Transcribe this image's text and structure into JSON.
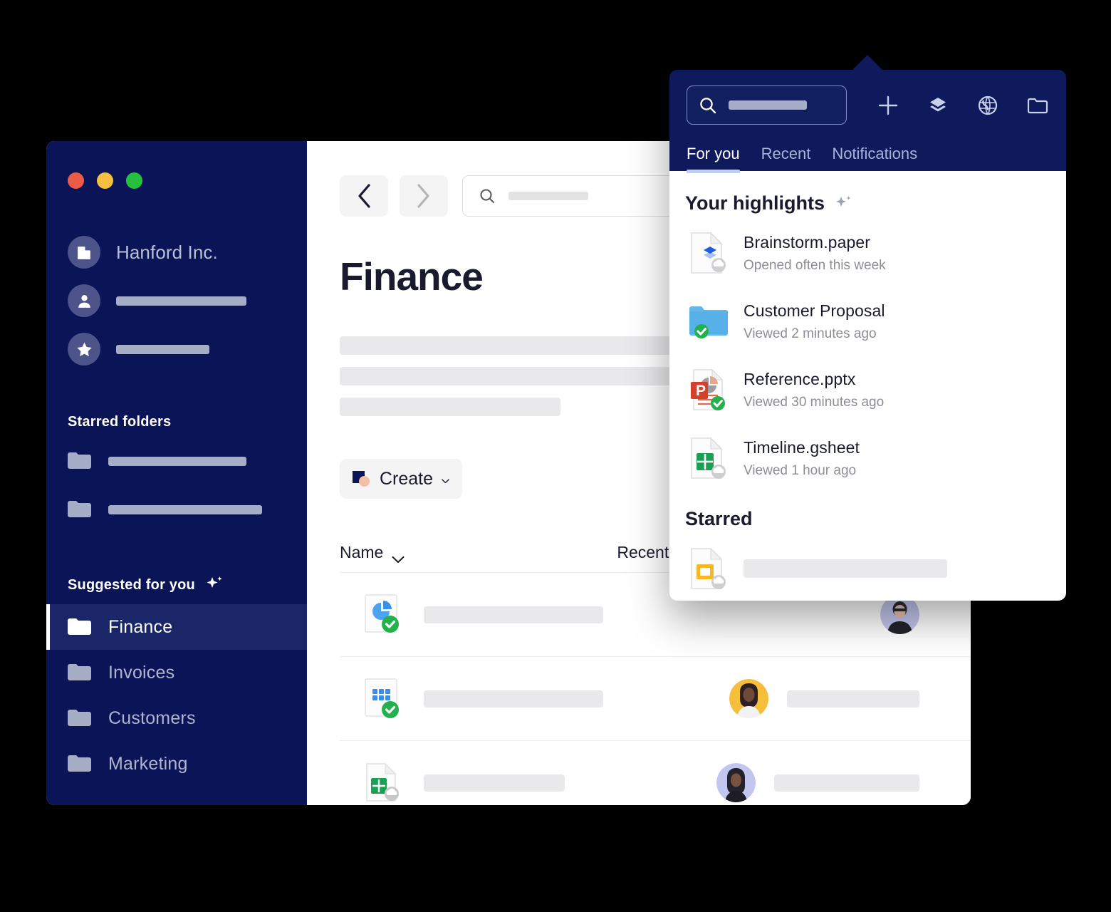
{
  "window": {
    "traffic_lights": [
      "close",
      "minimize",
      "maximize"
    ],
    "colors": {
      "navy": "#0b1457",
      "navy_panel": "#0e1a5c",
      "active_item": "#1b2668",
      "accent_underline": "#c3cdf2"
    }
  },
  "sidebar": {
    "org": {
      "name": "Hanford Inc.",
      "icon": "building-icon"
    },
    "account_rows": [
      {
        "icon": "person-icon",
        "placeholder": true
      },
      {
        "icon": "star-icon",
        "placeholder": true
      }
    ],
    "starred_folders": {
      "title": "Starred folders",
      "items": [
        {
          "icon": "folder-icon",
          "placeholder": true
        },
        {
          "icon": "folder-icon",
          "placeholder": true
        }
      ]
    },
    "suggested": {
      "title": "Suggested for you",
      "icon": "sparkle-icon",
      "items": [
        {
          "label": "Finance",
          "icon": "folder-icon",
          "active": true
        },
        {
          "label": "Invoices",
          "icon": "folder-icon",
          "active": false
        },
        {
          "label": "Customers",
          "icon": "folder-icon",
          "active": false
        },
        {
          "label": "Marketing",
          "icon": "folder-icon",
          "active": false
        }
      ]
    }
  },
  "main": {
    "nav": {
      "back_icon": "chevron-left-icon",
      "forward_icon": "chevron-right-icon"
    },
    "search": {
      "icon": "search-icon",
      "value": ""
    },
    "page_title": "Finance",
    "create_button": {
      "label": "Create",
      "chevron": "chevron-down-icon"
    },
    "list": {
      "columns": [
        {
          "label": "Name",
          "sort_icon": "chevron-down-icon"
        },
        {
          "label": "Recent"
        }
      ],
      "rows": [
        {
          "file_icon": "pie-chart-file-icon",
          "badge": "green-check-badge",
          "avatar": "avatar-lavender"
        },
        {
          "file_icon": "grid-sheet-file-icon",
          "badge": "green-check-badge",
          "avatar": "avatar-yellow"
        },
        {
          "file_icon": "green-sheet-file-icon",
          "badge": "cloud-badge",
          "avatar": "avatar-lavender-dots"
        }
      ]
    }
  },
  "popup": {
    "search": {
      "icon": "search-icon",
      "value": ""
    },
    "header_icons": [
      "plus-icon",
      "layers-icon",
      "globe-icon",
      "folder-icon"
    ],
    "tabs": [
      {
        "label": "For you",
        "active": true
      },
      {
        "label": "Recent",
        "active": false
      },
      {
        "label": "Notifications",
        "active": false
      }
    ],
    "highlights": {
      "title": "Your highlights",
      "icon": "sparkle-icon",
      "items": [
        {
          "name": "Brainstorm.paper",
          "sub": "Opened often this week",
          "file_icon": "paper-file-icon",
          "badge": "cloud-badge"
        },
        {
          "name": "Customer Proposal",
          "sub": "Viewed 2 minutes ago",
          "file_icon": "blue-folder-icon",
          "badge": "green-check-badge"
        },
        {
          "name": "Reference.pptx",
          "sub": "Viewed 30 minutes ago",
          "file_icon": "powerpoint-file-icon",
          "badge": "green-check-badge"
        },
        {
          "name": "Timeline.gsheet",
          "sub": "Viewed 1 hour ago",
          "file_icon": "green-sheet-file-icon",
          "badge": "cloud-badge"
        }
      ]
    },
    "starred": {
      "title": "Starred",
      "items": [
        {
          "file_icon": "yellow-slides-file-icon",
          "badge": "cloud-badge",
          "placeholder": true
        }
      ]
    }
  }
}
